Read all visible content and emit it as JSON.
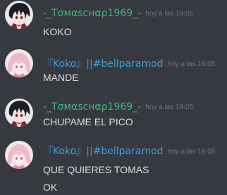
{
  "colors": {
    "background": "#36393f",
    "user1_name": "#43b581",
    "user2_name": "#3e9fe0",
    "text": "#dcddde",
    "timestamp": "#72767d"
  },
  "messages": [
    {
      "author": "-_Tσмαscнαρ1969_-",
      "avatar": "anime-dark-hair-avatar",
      "timestamp": "hoy a las 19:05",
      "lines": [
        "KOKO"
      ]
    },
    {
      "author": "『Koko』||#bellparamod",
      "avatar": "anime-pink-hair-avatar",
      "timestamp": "hoy a las 19:05",
      "lines": [
        "MANDE"
      ]
    },
    {
      "author": "-_Tσмαscнαρ1969_-",
      "avatar": "anime-dark-hair-avatar",
      "timestamp": "hoy a las 19:05",
      "lines": [
        "CHUPAME EL PICO"
      ]
    },
    {
      "author": "『Koko』||#bellparamod",
      "avatar": "anime-pink-hair-avatar",
      "timestamp": "hoy a las 19:05",
      "lines": [
        "QUE QUIERES TOMAS",
        "OK"
      ]
    }
  ]
}
